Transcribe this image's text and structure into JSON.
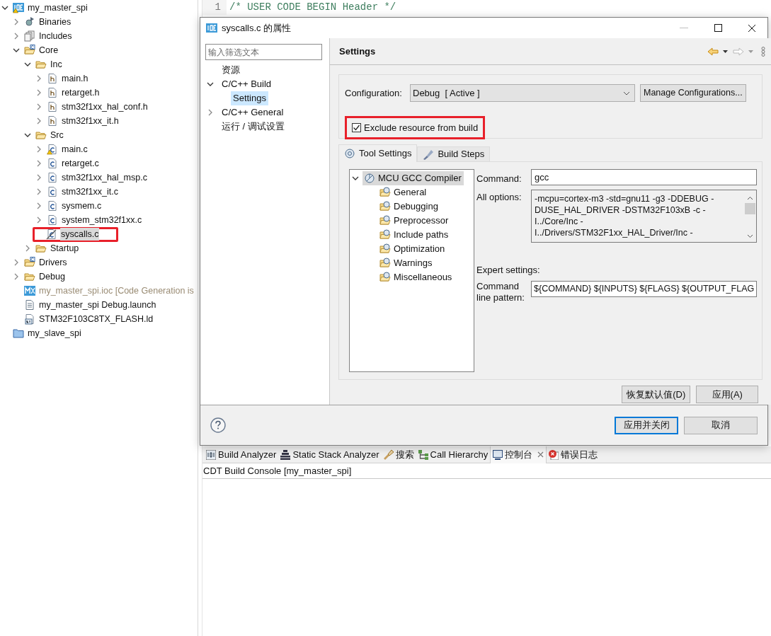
{
  "project_explorer": {
    "tree": [
      {
        "label": "my_master_spi",
        "kind": "project",
        "expanded": true,
        "warning": true,
        "selected": false,
        "children": [
          {
            "label": "Binaries",
            "kind": "binaries",
            "expanded": false,
            "selected": false
          },
          {
            "label": "Includes",
            "kind": "includes",
            "expanded": false,
            "selected": false
          },
          {
            "label": "Core",
            "kind": "source_folder",
            "expanded": true,
            "selected": false,
            "children": [
              {
                "label": "Inc",
                "kind": "folder",
                "expanded": true,
                "selected": false,
                "children": [
                  {
                    "label": "main.h",
                    "kind": "header",
                    "expanded": false,
                    "selected": false
                  },
                  {
                    "label": "retarget.h",
                    "kind": "header",
                    "expanded": false,
                    "selected": false
                  },
                  {
                    "label": "stm32f1xx_hal_conf.h",
                    "kind": "header",
                    "expanded": false,
                    "selected": false
                  },
                  {
                    "label": "stm32f1xx_it.h",
                    "kind": "header",
                    "expanded": false,
                    "selected": false
                  }
                ]
              },
              {
                "label": "Src",
                "kind": "folder",
                "expanded": true,
                "selected": false,
                "children": [
                  {
                    "label": "main.c",
                    "kind": "source",
                    "expanded": false,
                    "warning": true,
                    "selected": false
                  },
                  {
                    "label": "retarget.c",
                    "kind": "source",
                    "expanded": false,
                    "selected": false
                  },
                  {
                    "label": "stm32f1xx_hal_msp.c",
                    "kind": "source",
                    "expanded": false,
                    "selected": false
                  },
                  {
                    "label": "stm32f1xx_it.c",
                    "kind": "source",
                    "expanded": false,
                    "selected": false
                  },
                  {
                    "label": "sysmem.c",
                    "kind": "source",
                    "expanded": false,
                    "selected": false
                  },
                  {
                    "label": "system_stm32f1xx.c",
                    "kind": "source",
                    "expanded": false,
                    "selected": false
                  },
                  {
                    "label": "syscalls.c",
                    "kind": "excluded",
                    "selected": true,
                    "annotated": true
                  }
                ]
              },
              {
                "label": "Startup",
                "kind": "folder",
                "expanded": false,
                "selected": false
              }
            ]
          },
          {
            "label": "Drivers",
            "kind": "source_folder",
            "expanded": false,
            "selected": false
          },
          {
            "label": "Debug",
            "kind": "folder",
            "expanded": false,
            "selected": false
          },
          {
            "label": "my_master_spi.ioc [Code Generation is",
            "kind": "mx",
            "dimmed": true,
            "selected": false
          },
          {
            "label": "my_master_spi Debug.launch",
            "kind": "launch",
            "selected": false
          },
          {
            "label": "STM32F103C8TX_FLASH.ld",
            "kind": "linker",
            "selected": false
          }
        ]
      },
      {
        "label": "my_slave_spi",
        "kind": "closed_project",
        "selected": false
      }
    ]
  },
  "editor": {
    "lines": [
      {
        "number": "1",
        "text": "/* USER CODE BEGIN Header */"
      }
    ]
  },
  "dialog": {
    "title": "syscalls.c 的属性",
    "filter_placeholder": "输入筛选文本",
    "nav": [
      {
        "label": "资源",
        "selected": false
      },
      {
        "label": "C/C++ Build",
        "expanded": true,
        "selected": false,
        "children": [
          {
            "label": "Settings",
            "selected": true
          }
        ]
      },
      {
        "label": "C/C++ General",
        "expanded": false,
        "selected": false
      },
      {
        "label": "运行 / 调试设置",
        "selected": false
      }
    ],
    "page_title": "Settings",
    "configuration": {
      "label": "Configuration:",
      "value": "Debug  [ Active ]",
      "button": "Manage Configurations..."
    },
    "exclude": {
      "label": "Exclude resource from build",
      "checked": true,
      "annotated": true
    },
    "tabs": [
      {
        "label": "Tool Settings",
        "kind": "tool",
        "selected": true
      },
      {
        "label": "Build Steps",
        "kind": "steps",
        "selected": false
      }
    ],
    "tool_tree": [
      {
        "label": "MCU GCC Compiler",
        "expanded": true,
        "selected": true,
        "children": [
          {
            "label": "General",
            "selected": false
          },
          {
            "label": "Debugging",
            "selected": false
          },
          {
            "label": "Preprocessor",
            "selected": false
          },
          {
            "label": "Include paths",
            "selected": false
          },
          {
            "label": "Optimization",
            "selected": false
          },
          {
            "label": "Warnings",
            "selected": false
          },
          {
            "label": "Miscellaneous",
            "selected": false
          }
        ]
      }
    ],
    "command": {
      "label": "Command:",
      "value": "gcc"
    },
    "all_options": {
      "label": "All options:",
      "lines": [
        "-mcpu=cortex-m3 -std=gnu11 -g3 -DDEBUG -",
        "DUSE_HAL_DRIVER -DSTM32F103xB -c -",
        "I../Core/Inc -",
        "I../Drivers/STM32F1xx_HAL_Driver/Inc -"
      ]
    },
    "expert": {
      "heading": "Expert settings:",
      "label": "Command line pattern:",
      "value": "${COMMAND} ${INPUTS} ${FLAGS} ${OUTPUT_FLAG"
    },
    "page_buttons": [
      "恢复默认值(D)",
      "应用(A)"
    ],
    "footer_buttons": [
      {
        "label": "应用并关闭",
        "default": true
      },
      {
        "label": "取消",
        "default": false
      }
    ]
  },
  "bottom_panel": {
    "tabs": [
      {
        "label": "Build Analyzer",
        "kind": "binary",
        "selected": false,
        "closable": false
      },
      {
        "label": "Static Stack Analyzer",
        "kind": "stack",
        "selected": false,
        "closable": false
      },
      {
        "label": "搜索",
        "kind": "torch",
        "selected": false,
        "closable": false
      },
      {
        "label": "Call Hierarchy",
        "kind": "hierarchy",
        "selected": false,
        "closable": false
      },
      {
        "label": "控制台",
        "kind": "monitor",
        "selected": true,
        "closable": true
      },
      {
        "label": "错误日志",
        "kind": "error",
        "selected": false,
        "closable": false
      }
    ],
    "console_title": "CDT Build Console [my_master_spi]"
  }
}
